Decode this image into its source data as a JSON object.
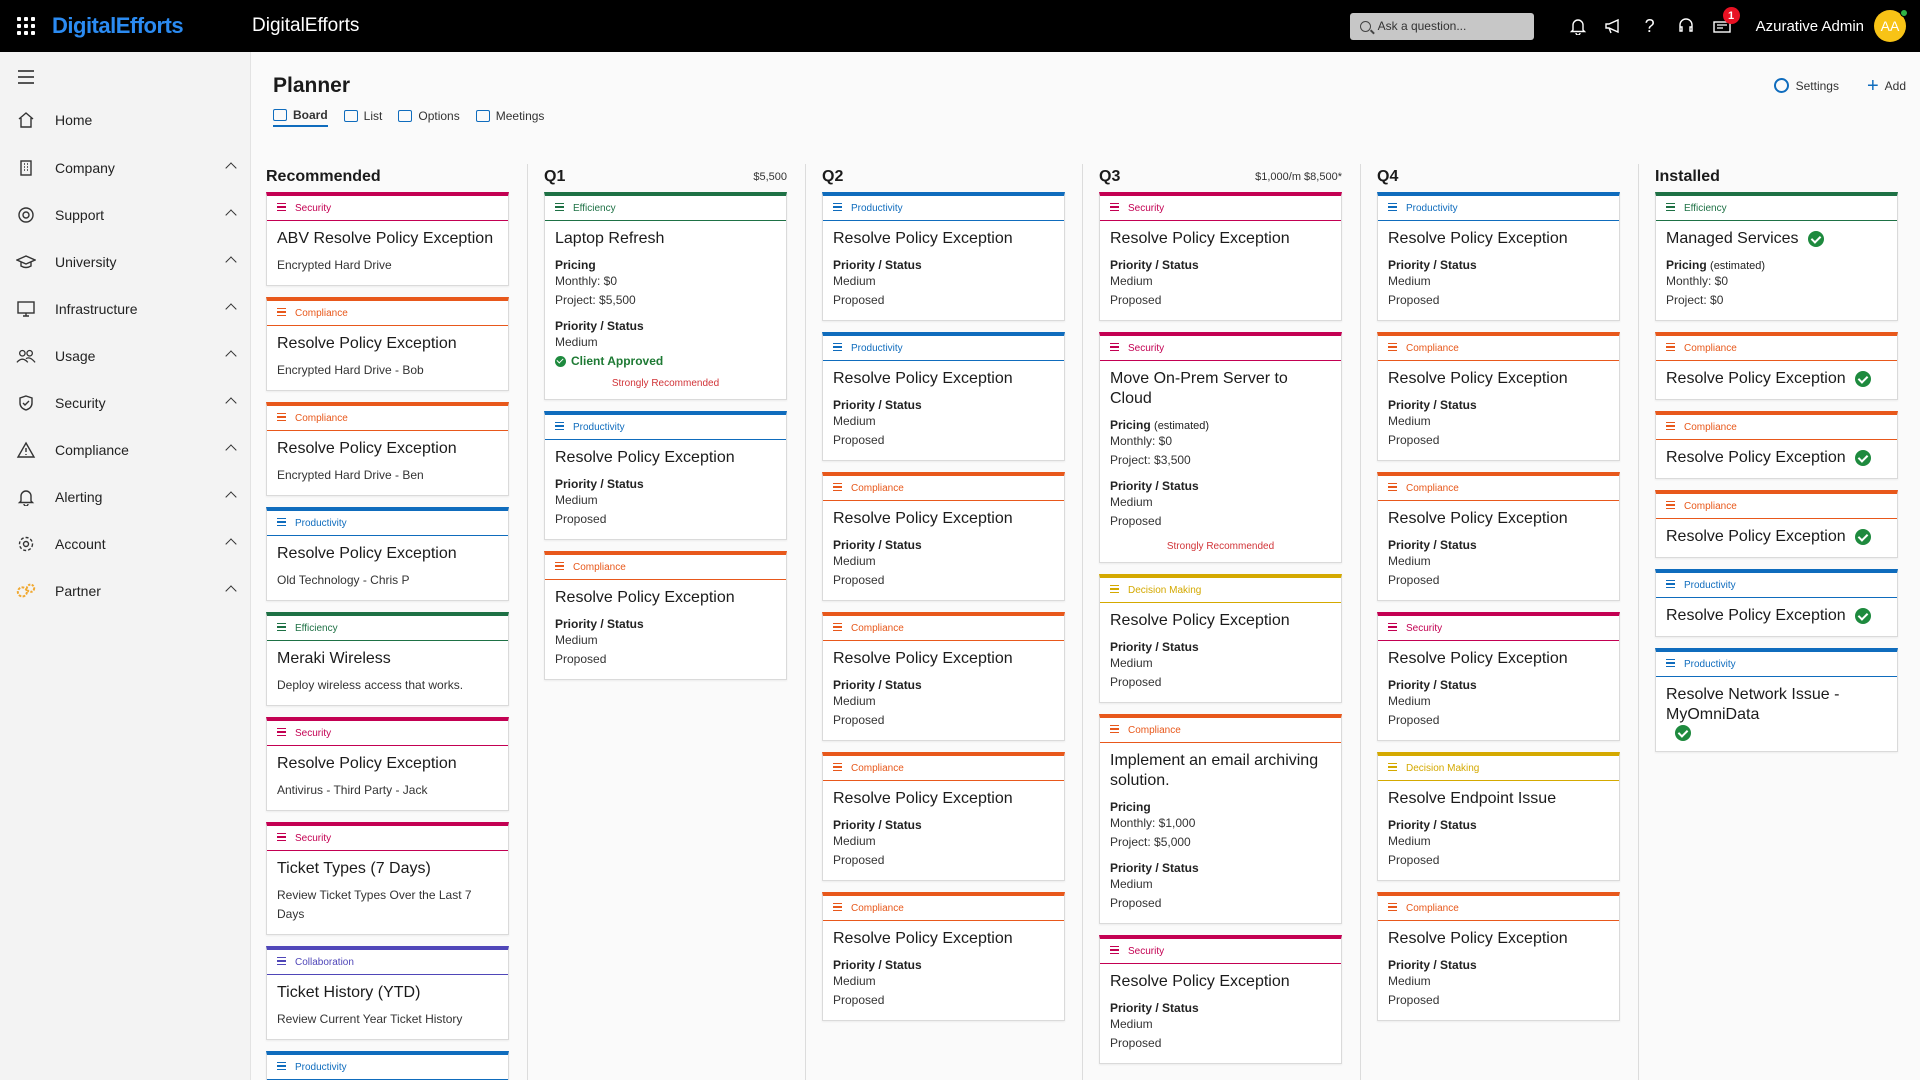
{
  "topbar": {
    "brand": "DigitalEfforts",
    "app_name": "DigitalEfforts",
    "search_placeholder": "Ask a question...",
    "notification_badge": "1",
    "user_name": "Azurative Admin",
    "avatar_initials": "AA"
  },
  "sidebar": {
    "items": [
      {
        "label": "Home",
        "icon": "home-icon",
        "chevron": false
      },
      {
        "label": "Company",
        "icon": "building-icon",
        "chevron": true
      },
      {
        "label": "Support",
        "icon": "lifebuoy-icon",
        "chevron": true
      },
      {
        "label": "University",
        "icon": "graduation-cap-icon",
        "chevron": true
      },
      {
        "label": "Infrastructure",
        "icon": "monitor-icon",
        "chevron": true
      },
      {
        "label": "Usage",
        "icon": "people-icon",
        "chevron": true
      },
      {
        "label": "Security",
        "icon": "shield-icon",
        "chevron": true
      },
      {
        "label": "Compliance",
        "icon": "warning-icon",
        "chevron": true
      },
      {
        "label": "Alerting",
        "icon": "bell-icon",
        "chevron": true
      },
      {
        "label": "Account",
        "icon": "gear-icon",
        "chevron": true
      },
      {
        "label": "Partner",
        "icon": "partner-gears-icon",
        "chevron": true
      }
    ]
  },
  "page": {
    "title": "Planner",
    "tabs": [
      "Board",
      "List",
      "Options",
      "Meetings"
    ],
    "settings_label": "Settings",
    "add_label": "Add"
  },
  "colors": {
    "Security": "#c30052",
    "Compliance": "#e8581b",
    "Productivity": "#0f6cbd",
    "Efficiency": "#1e7145",
    "Collaboration": "#4f46b8",
    "Decision Making": "#d4a900"
  },
  "board": {
    "columns": [
      {
        "name": "Recommended",
        "total": "",
        "cards": [
          {
            "cat": "Security",
            "title": "ABV Resolve Policy Exception",
            "sub": "Encrypted Hard Drive"
          },
          {
            "cat": "Compliance",
            "title": "Resolve Policy Exception",
            "sub": "Encrypted Hard Drive - Bob"
          },
          {
            "cat": "Compliance",
            "title": "Resolve Policy Exception",
            "sub": "Encrypted Hard Drive - Ben"
          },
          {
            "cat": "Productivity",
            "title": "Resolve Policy Exception",
            "sub": "Old Technology - Chris P"
          },
          {
            "cat": "Efficiency",
            "title": "Meraki Wireless",
            "sub": "Deploy wireless access that works."
          },
          {
            "cat": "Security",
            "title": "Resolve Policy Exception",
            "sub": "Antivirus - Third Party - Jack"
          },
          {
            "cat": "Security",
            "title": "Ticket Types (7 Days)",
            "sub": "Review Ticket Types Over the Last 7 Days"
          },
          {
            "cat": "Collaboration",
            "title": "Ticket History (YTD)",
            "sub": "Review Current Year Ticket History"
          },
          {
            "cat": "Productivity",
            "title": "",
            "sub": ""
          }
        ]
      },
      {
        "name": "Q1",
        "total": "$5,500",
        "cards": [
          {
            "cat": "Efficiency",
            "title": "Laptop Refresh",
            "pricing": {
              "label": "Pricing",
              "est": "",
              "monthly": "Monthly: $0",
              "project": "Project: $5,500"
            },
            "ps": {
              "label": "Priority / Status",
              "priority": "Medium",
              "status": ""
            },
            "approved": "Client Approved",
            "strong": "Strongly Recommended"
          },
          {
            "cat": "Productivity",
            "title": "Resolve Policy Exception",
            "ps": {
              "label": "Priority / Status",
              "priority": "Medium",
              "status": "Proposed"
            }
          },
          {
            "cat": "Compliance",
            "title": "Resolve Policy Exception",
            "ps": {
              "label": "Priority / Status",
              "priority": "Medium",
              "status": "Proposed"
            }
          }
        ]
      },
      {
        "name": "Q2",
        "total": "",
        "cards": [
          {
            "cat": "Productivity",
            "title": "Resolve Policy Exception",
            "ps": {
              "label": "Priority / Status",
              "priority": "Medium",
              "status": "Proposed"
            }
          },
          {
            "cat": "Productivity",
            "title": "Resolve Policy Exception",
            "ps": {
              "label": "Priority / Status",
              "priority": "Medium",
              "status": "Proposed"
            }
          },
          {
            "cat": "Compliance",
            "title": "Resolve Policy Exception",
            "ps": {
              "label": "Priority / Status",
              "priority": "Medium",
              "status": "Proposed"
            }
          },
          {
            "cat": "Compliance",
            "title": "Resolve Policy Exception",
            "ps": {
              "label": "Priority / Status",
              "priority": "Medium",
              "status": "Proposed"
            }
          },
          {
            "cat": "Compliance",
            "title": "Resolve Policy Exception",
            "ps": {
              "label": "Priority / Status",
              "priority": "Medium",
              "status": "Proposed"
            }
          },
          {
            "cat": "Compliance",
            "title": "Resolve Policy Exception",
            "ps": {
              "label": "Priority / Status",
              "priority": "Medium",
              "status": "Proposed"
            }
          }
        ]
      },
      {
        "name": "Q3",
        "total": "$1,000/m $8,500*",
        "cards": [
          {
            "cat": "Security",
            "title": "Resolve Policy Exception",
            "ps": {
              "label": "Priority / Status",
              "priority": "Medium",
              "status": "Proposed"
            }
          },
          {
            "cat": "Security",
            "title": "Move On-Prem Server to Cloud",
            "pricing": {
              "label": "Pricing",
              "est": "(estimated)",
              "monthly": "Monthly: $0",
              "project": "Project: $3,500"
            },
            "ps": {
              "label": "Priority / Status",
              "priority": "Medium",
              "status": "Proposed"
            },
            "strong": "Strongly Recommended"
          },
          {
            "cat": "Decision Making",
            "title": "Resolve Policy Exception",
            "ps": {
              "label": "Priority / Status",
              "priority": "Medium",
              "status": "Proposed"
            }
          },
          {
            "cat": "Compliance",
            "title": "Implement an email archiving solution.",
            "pricing": {
              "label": "Pricing",
              "est": "",
              "monthly": "Monthly: $1,000",
              "project": "Project: $5,000"
            },
            "ps": {
              "label": "Priority / Status",
              "priority": "Medium",
              "status": "Proposed"
            }
          },
          {
            "cat": "Security",
            "title": "Resolve Policy Exception",
            "ps": {
              "label": "Priority / Status",
              "priority": "Medium",
              "status": "Proposed"
            }
          }
        ]
      },
      {
        "name": "Q4",
        "total": "",
        "cards": [
          {
            "cat": "Productivity",
            "title": "Resolve Policy Exception",
            "ps": {
              "label": "Priority / Status",
              "priority": "Medium",
              "status": "Proposed"
            }
          },
          {
            "cat": "Compliance",
            "title": "Resolve Policy Exception",
            "ps": {
              "label": "Priority / Status",
              "priority": "Medium",
              "status": "Proposed"
            }
          },
          {
            "cat": "Compliance",
            "title": "Resolve Policy Exception",
            "ps": {
              "label": "Priority / Status",
              "priority": "Medium",
              "status": "Proposed"
            }
          },
          {
            "cat": "Security",
            "title": "Resolve Policy Exception",
            "ps": {
              "label": "Priority / Status",
              "priority": "Medium",
              "status": "Proposed"
            }
          },
          {
            "cat": "Decision Making",
            "title": "Resolve Endpoint Issue",
            "ps": {
              "label": "Priority / Status",
              "priority": "Medium",
              "status": "Proposed"
            }
          },
          {
            "cat": "Compliance",
            "title": "Resolve Policy Exception",
            "ps": {
              "label": "Priority / Status",
              "priority": "Medium",
              "status": "Proposed"
            }
          }
        ]
      },
      {
        "name": "Installed",
        "total": "",
        "cards": [
          {
            "cat": "Efficiency",
            "title": "Managed Services",
            "done": true,
            "pricing": {
              "label": "Pricing",
              "est": "(estimated)",
              "monthly": "Monthly: $0",
              "project": "Project: $0"
            }
          },
          {
            "cat": "Compliance",
            "title": "Resolve Policy Exception",
            "done": true
          },
          {
            "cat": "Compliance",
            "title": "Resolve Policy Exception",
            "done": true
          },
          {
            "cat": "Compliance",
            "title": "Resolve Policy Exception",
            "done": true
          },
          {
            "cat": "Productivity",
            "title": "Resolve Policy Exception",
            "done": true
          },
          {
            "cat": "Productivity",
            "title": "Resolve Network Issue - MyOmniData",
            "done": true
          }
        ]
      }
    ]
  }
}
